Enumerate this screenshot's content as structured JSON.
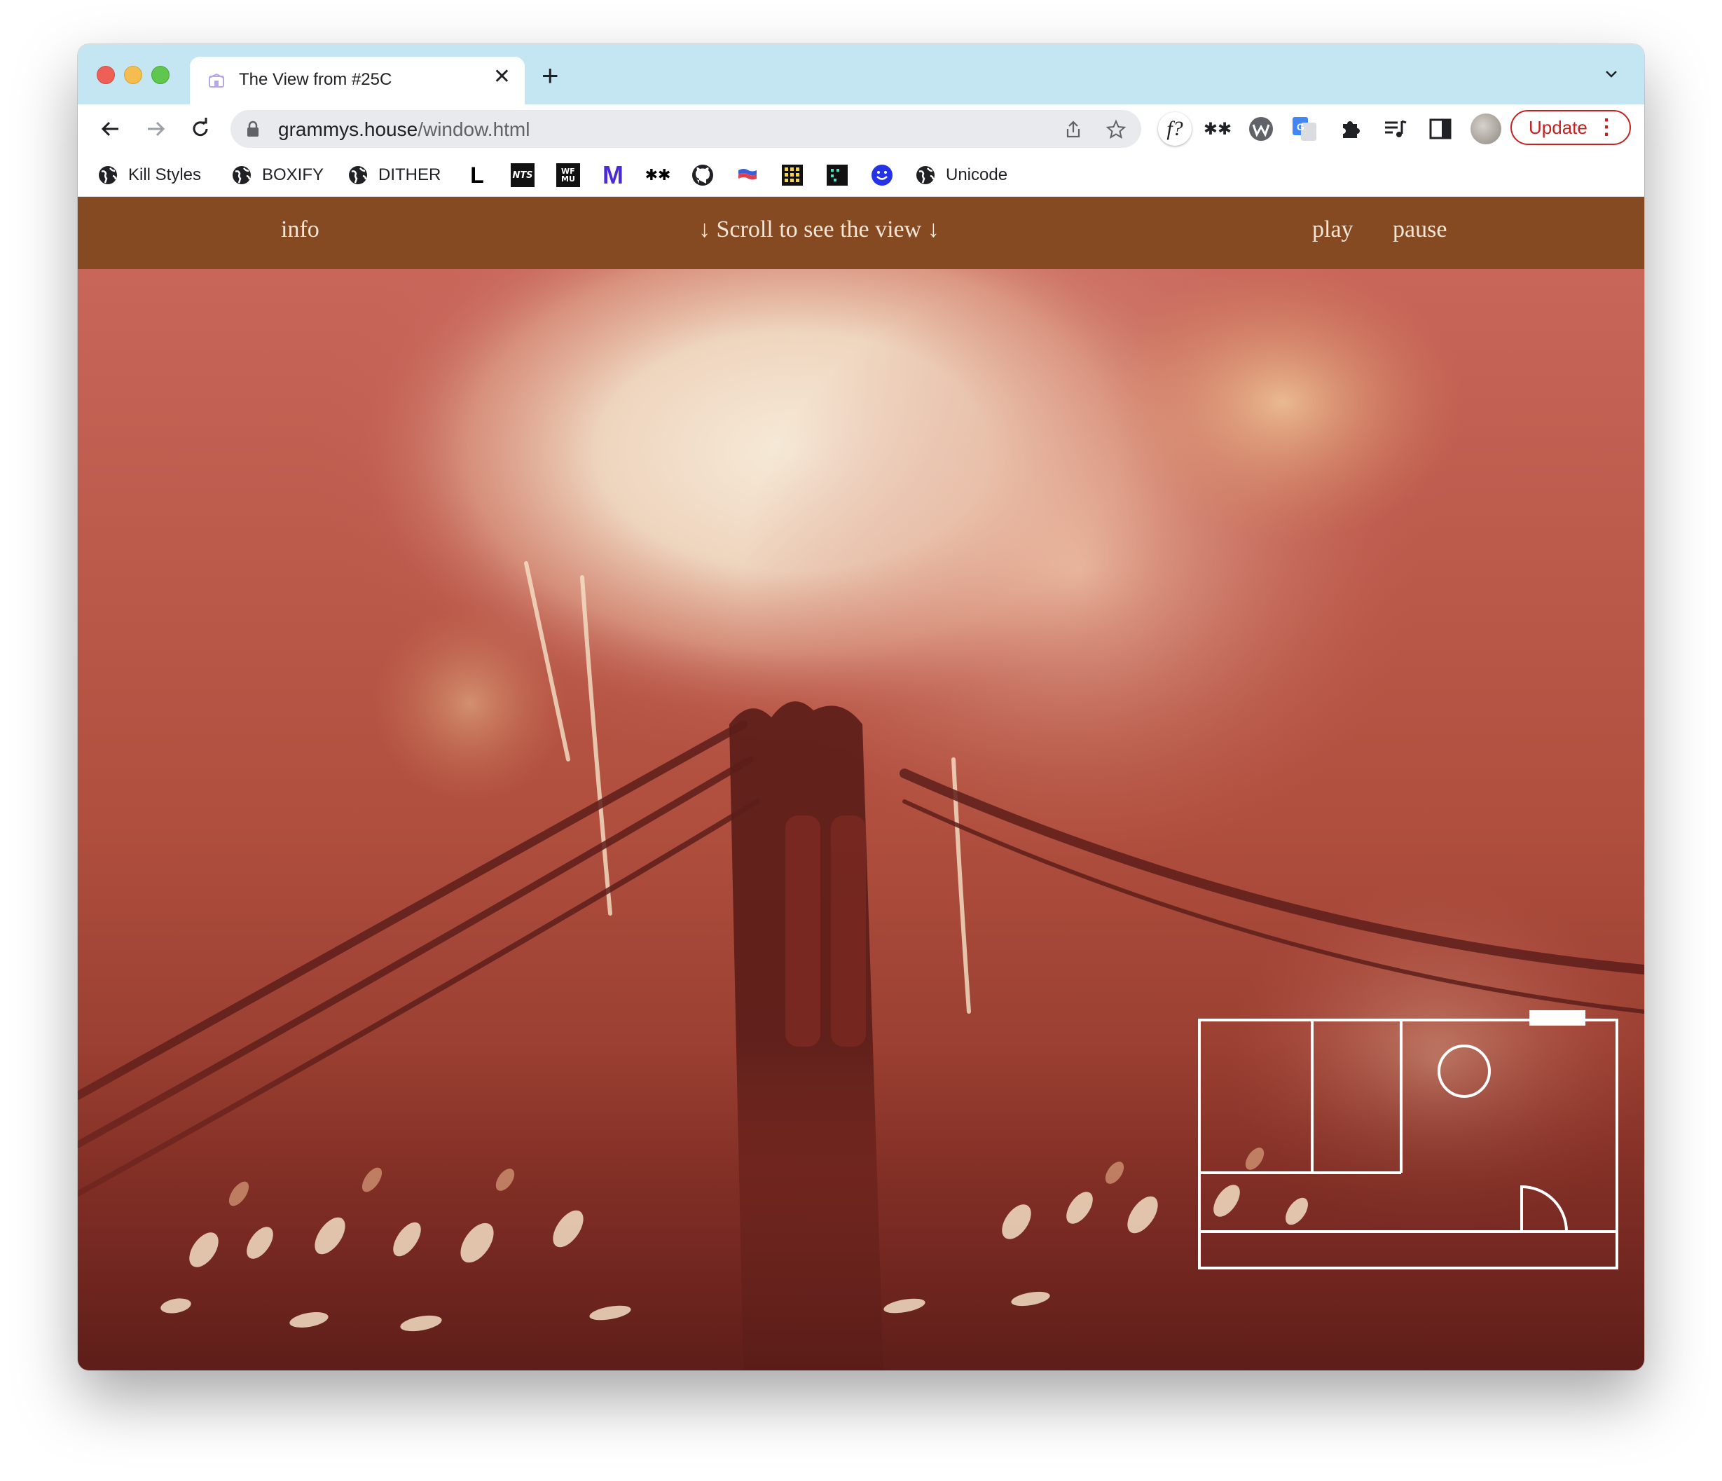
{
  "browser": {
    "tab": {
      "title": "The View from #25C"
    },
    "url": {
      "domain": "grammys.house",
      "path": "/window.html"
    },
    "update_label": "Update",
    "extensions": [
      "font-question-icon",
      "double-asterisk-icon",
      "w-circle-icon",
      "google-translate-icon",
      "puzzle-icon",
      "media-queue-icon",
      "side-panel-icon",
      "profile-avatar"
    ]
  },
  "bookmarks": {
    "kill_styles": "Kill Styles",
    "boxify": "BOXIFY",
    "dither": "DITHER",
    "unicode": "Unicode",
    "icon_items": [
      "L",
      "NTS",
      "WFMU",
      "M",
      "**",
      "github",
      "flag",
      "grid",
      "pixel",
      "smiley"
    ]
  },
  "site": {
    "nav": {
      "info": "info",
      "scroll_hint": "↓ Scroll to see the view ↓",
      "play": "play",
      "pause": "pause"
    },
    "colors": {
      "nav_bg": "#864a23",
      "nav_text": "#f3e6d6",
      "photo_tone": "#9c3a2a"
    },
    "photo": "fireworks-over-brooklyn-bridge"
  }
}
